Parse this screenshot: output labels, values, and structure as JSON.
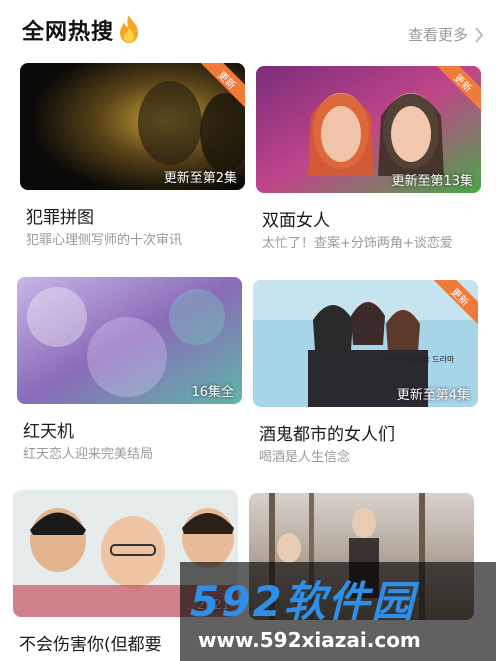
{
  "header": {
    "title": "全网热搜",
    "more_label": "查看更多"
  },
  "cards": [
    {
      "title": "犯罪拼图",
      "subtitle": "犯罪心理侧写师的十次审讯",
      "badge": "更新至第2集",
      "ribbon": "更新"
    },
    {
      "title": "双面女人",
      "subtitle": "太忙了！查案+分饰两角+谈恋爱",
      "badge": "更新至第13集",
      "ribbon": "更新"
    },
    {
      "title": "红天机",
      "subtitle": "红天恋人迎来完美结局",
      "badge": "16集全",
      "ribbon": ""
    },
    {
      "title": "酒鬼都市的女人们",
      "subtitle": "喝酒是人生信念",
      "badge": "更新至第4集",
      "ribbon": "更新",
      "poster_text": "본격 기승전술 드라마"
    },
    {
      "title": "不会伤害你(但都要",
      "subtitle": "",
      "badge": "2021",
      "ribbon": ""
    },
    {
      "title": "",
      "subtitle": "",
      "badge": "",
      "ribbon": ""
    }
  ],
  "watermark": {
    "logo": "592软件园",
    "url": "www.592xiazai.com"
  },
  "colors": {
    "ribbon": "#f07a3a",
    "more_text": "#999999",
    "watermark_logo": "#2f8fe8"
  }
}
